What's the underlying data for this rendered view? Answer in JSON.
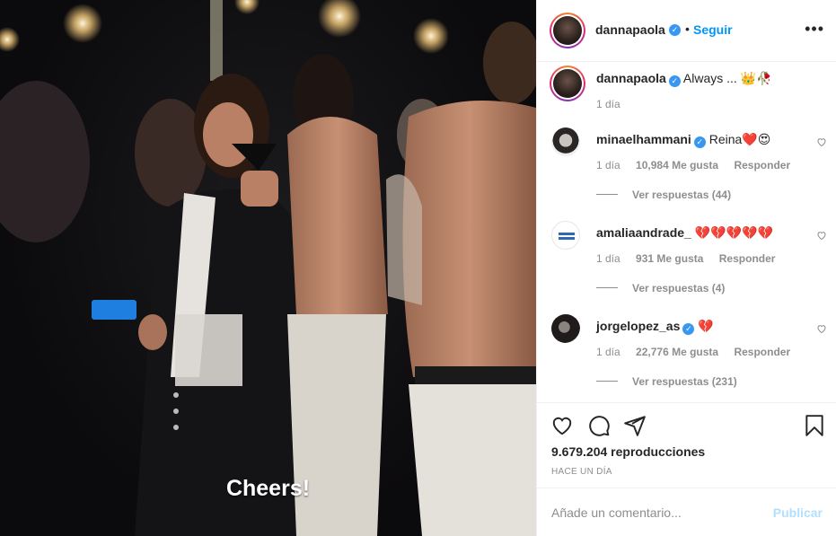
{
  "post": {
    "subtitle": "Cheers!"
  },
  "header": {
    "username": "dannapaola",
    "verified_glyph": "✓",
    "separator": "•",
    "follow_label": "Seguir",
    "more_label": "•••"
  },
  "caption": {
    "username": "dannapaola",
    "text": "Always ... 👑🥀",
    "time": "1 día"
  },
  "comments": [
    {
      "username": "minaelhammani",
      "text": "Reina❤️😍",
      "time": "1 día",
      "likes": "10,984 Me gusta",
      "reply_label": "Responder",
      "replies_label": "Ver respuestas (44)"
    },
    {
      "username": "amaliaandrade_",
      "text": "💔💔💔💔💔",
      "time": "1 día",
      "likes": "931 Me gusta",
      "reply_label": "Responder",
      "replies_label": "Ver respuestas (4)"
    },
    {
      "username": "jorgelopez_as",
      "text": "💔",
      "time": "1 día",
      "likes": "22,776 Me gusta",
      "reply_label": "Responder",
      "replies_label": "Ver respuestas (231)"
    }
  ],
  "actions": {
    "icons": [
      "heart-icon",
      "comment-icon",
      "share-icon",
      "bookmark-icon"
    ],
    "views": "9.679.204 reproducciones",
    "posted_ago": "HACE UN DÍA"
  },
  "composer": {
    "placeholder": "Añade un comentario...",
    "publish_label": "Publicar"
  },
  "colors": {
    "accent": "#0095f6",
    "verified": "#3897f0",
    "muted": "#8e8e8e",
    "publish_disabled": "#b2dffc"
  }
}
